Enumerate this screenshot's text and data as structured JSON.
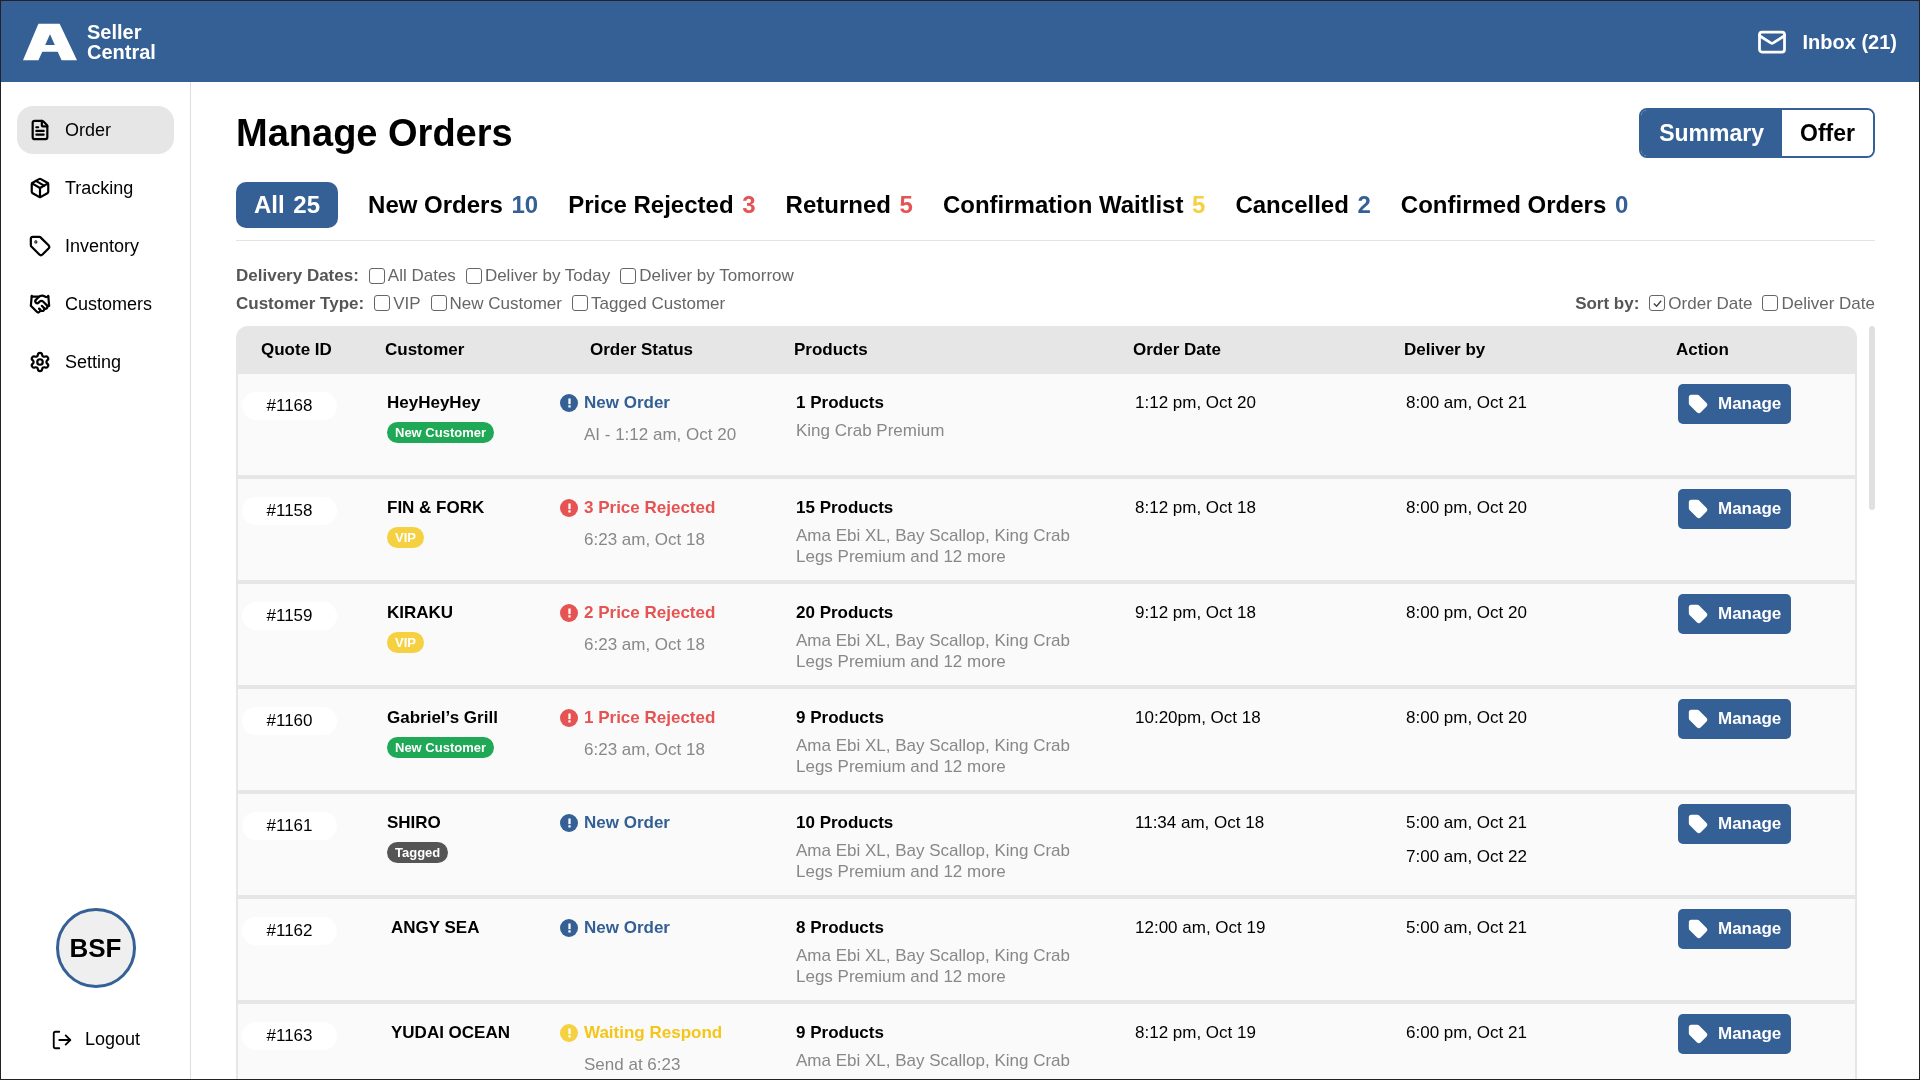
{
  "header": {
    "brand": [
      "Seller",
      "Central"
    ],
    "inbox": "Inbox (21)"
  },
  "sidebar": {
    "items": [
      {
        "label": "Order",
        "selected": true
      },
      {
        "label": "Tracking",
        "selected": false
      },
      {
        "label": "Inventory",
        "selected": false
      },
      {
        "label": "Customers",
        "selected": false
      },
      {
        "label": "Setting",
        "selected": false
      }
    ],
    "avatar": "BSF",
    "logout": "Logout"
  },
  "title": "Manage Orders",
  "view_toggle": [
    {
      "label": "Summary",
      "selected": true
    },
    {
      "label": "Offer",
      "selected": false
    }
  ],
  "tabs": [
    {
      "label": "All",
      "count": "25",
      "color": "#ffffff",
      "selected": true
    },
    {
      "label": "New Orders",
      "count": "10",
      "color": "#346095",
      "selected": false
    },
    {
      "label": "Price Rejected",
      "count": "3",
      "color": "#e55353",
      "selected": false
    },
    {
      "label": "Returned",
      "count": "5",
      "color": "#e55353",
      "selected": false
    },
    {
      "label": "Confirmation Waitlist",
      "count": "5",
      "color": "#f5d142",
      "selected": false
    },
    {
      "label": "Cancelled",
      "count": "2",
      "color": "#346095",
      "selected": false
    },
    {
      "label": "Confirmed Orders",
      "count": "0",
      "color": "#346095",
      "selected": false
    }
  ],
  "filters": [
    {
      "label": "Delivery Dates:",
      "options": [
        {
          "label": "All Dates",
          "checked": false
        },
        {
          "label": "Deliver by Today",
          "checked": false
        },
        {
          "label": "Deliver by Tomorrow",
          "checked": false
        }
      ]
    },
    {
      "label": "Customer Type:",
      "options": [
        {
          "label": "VIP",
          "checked": false
        },
        {
          "label": "New Customer",
          "checked": false
        },
        {
          "label": "Tagged Customer",
          "checked": false
        }
      ]
    }
  ],
  "sort": {
    "label": "Sort by:",
    "options": [
      {
        "label": "Order Date",
        "checked": true
      },
      {
        "label": "Deliver Date",
        "checked": false
      }
    ]
  },
  "table": {
    "columns": [
      "Quote ID",
      "Customer",
      "Order Status",
      "Products",
      "Order Date",
      "Deliver by",
      "Action"
    ],
    "rows": [
      {
        "id": "#1168",
        "customer": "HeyHeyHey",
        "tag": {
          "kind": "new",
          "label": "New Customer"
        },
        "status": {
          "kind": "new",
          "label": "New Order",
          "time": "AI - 1:12 am, Oct 20"
        },
        "products": "1 Products",
        "product_list": [
          "King Crab Premium"
        ],
        "order_date": "1:12 pm, Oct 20",
        "deliver_by": [
          "8:00 am, Oct 21"
        ],
        "action": "Manage"
      },
      {
        "id": "#1158",
        "customer": "FIN & FORK",
        "tag": {
          "kind": "vip",
          "label": "VIP"
        },
        "status": {
          "kind": "rejected",
          "label": "3 Price Rejected",
          "time": "6:23 am, Oct 18"
        },
        "products": "15 Products",
        "product_list": [
          "Ama Ebi XL, Bay Scallop, King Crab",
          "Legs Premium and 12 more"
        ],
        "order_date": "8:12 pm, Oct 18",
        "deliver_by": [
          "8:00 pm, Oct 20"
        ],
        "action": "Manage"
      },
      {
        "id": "#1159",
        "customer": "KIRAKU",
        "tag": {
          "kind": "vip",
          "label": "VIP"
        },
        "status": {
          "kind": "rejected",
          "label": "2 Price Rejected",
          "time": "6:23 am, Oct 18"
        },
        "products": "20 Products",
        "product_list": [
          "Ama Ebi XL, Bay Scallop, King Crab",
          "Legs Premium and 12 more"
        ],
        "order_date": "9:12 pm, Oct 18",
        "deliver_by": [
          "8:00 pm, Oct 20"
        ],
        "action": "Manage"
      },
      {
        "id": "#1160",
        "customer": "Gabriel’s Grill",
        "tag": {
          "kind": "new",
          "label": "New Customer"
        },
        "status": {
          "kind": "rejected",
          "label": "1 Price Rejected",
          "time": "6:23 am, Oct 18"
        },
        "products": "9 Products",
        "product_list": [
          "Ama Ebi XL, Bay Scallop, King Crab",
          "Legs Premium and 12 more"
        ],
        "order_date": "10:20pm, Oct 18",
        "deliver_by": [
          "8:00 pm, Oct 20"
        ],
        "action": "Manage"
      },
      {
        "id": "#1161",
        "customer": "SHIRO",
        "tag": {
          "kind": "tagged",
          "label": "Tagged"
        },
        "status": {
          "kind": "new",
          "label": "New Order"
        },
        "products": "10 Products",
        "product_list": [
          "Ama Ebi XL, Bay Scallop, King Crab",
          "Legs Premium and 12 more"
        ],
        "order_date": "11:34 am, Oct 18",
        "deliver_by": [
          "5:00 am, Oct 21",
          "7:00 am, Oct 22"
        ],
        "action": "Manage"
      },
      {
        "id": "#1162",
        "customer": "ANGY SEA",
        "status": {
          "kind": "new",
          "label": "New Order"
        },
        "products": "8 Products",
        "product_list": [
          "Ama Ebi XL, Bay Scallop, King Crab",
          "Legs Premium and 12 more"
        ],
        "order_date": "12:00 am, Oct 19",
        "deliver_by": [
          "5:00 am, Oct 21"
        ],
        "action": "Manage"
      },
      {
        "id": "#1163",
        "customer": "YUDAI OCEAN",
        "status": {
          "kind": "waiting",
          "label": "Waiting Respond",
          "time": "Send at 6:23"
        },
        "products": "9 Products",
        "product_list": [
          "Ama Ebi XL, Bay Scallop, King Crab"
        ],
        "order_date": "8:12 pm, Oct 19",
        "deliver_by": [
          "6:00 pm, Oct 21"
        ],
        "action": "Manage"
      }
    ]
  }
}
